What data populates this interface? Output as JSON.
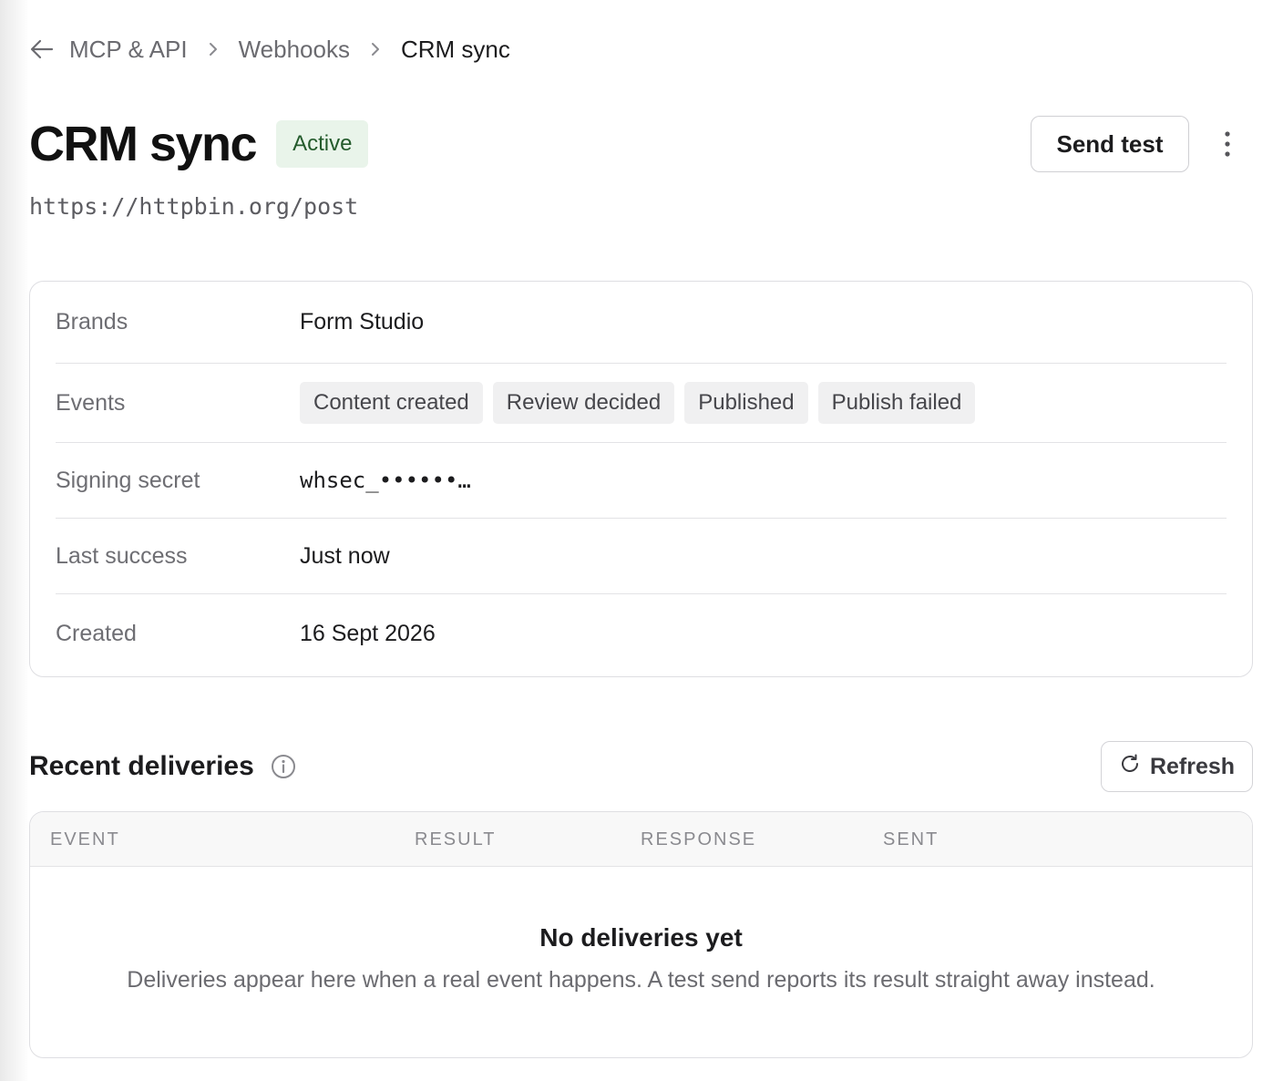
{
  "breadcrumb": {
    "items": [
      "MCP & API",
      "Webhooks"
    ],
    "current": "CRM sync"
  },
  "header": {
    "title": "CRM sync",
    "status": "Active",
    "send_test_label": "Send test",
    "url": "https://httpbin.org/post"
  },
  "details": {
    "brands_label": "Brands",
    "brands_value": "Form Studio",
    "events_label": "Events",
    "events": [
      "Content created",
      "Review decided",
      "Published",
      "Publish failed"
    ],
    "secret_label": "Signing secret",
    "secret_value": "whsec_••••••…",
    "last_success_label": "Last success",
    "last_success_value": "Just now",
    "created_label": "Created",
    "created_value": "16 Sept 2026"
  },
  "deliveries": {
    "title": "Recent deliveries",
    "refresh_label": "Refresh",
    "columns": [
      "EVENT",
      "RESULT",
      "RESPONSE",
      "SENT"
    ],
    "empty_title": "No deliveries yet",
    "empty_description": "Deliveries appear here when a real event happens. A test send reports its result straight away instead."
  },
  "colors": {
    "status_bg": "#e9f4ea",
    "status_text": "#245b2c",
    "border": "#dedee2"
  }
}
